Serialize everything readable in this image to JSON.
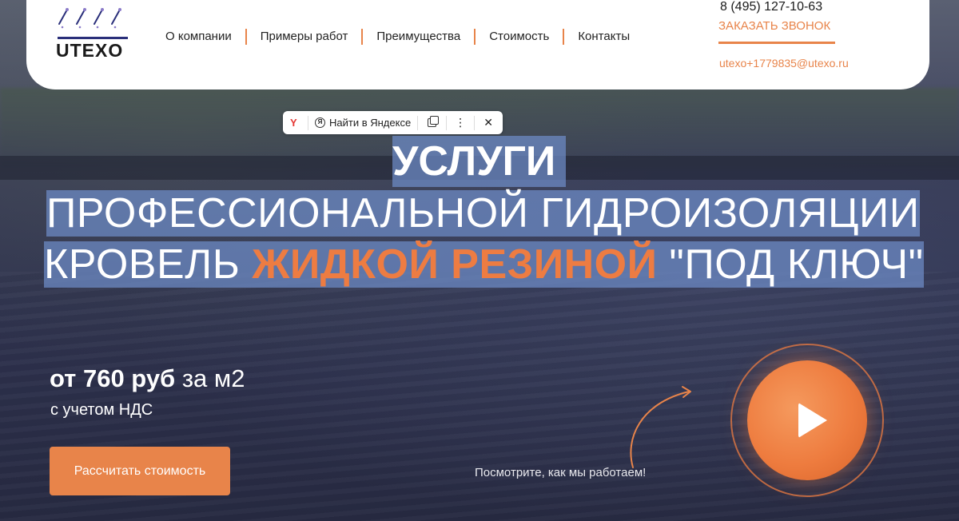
{
  "header": {
    "logo_text": "UTEXO",
    "nav": [
      "О компании",
      "Примеры работ",
      "Преимущества",
      "Стоимость",
      "Контакты"
    ],
    "phone": "8 (495) 127-10-63",
    "callback_label": "ЗАКАЗАТЬ ЗВОНОК",
    "email": "utexo+1779835@utexo.ru"
  },
  "yandex_popup": {
    "search_label": "Найти в Яндексе",
    "icons": [
      "yandex-logo-icon",
      "search-icon",
      "copy-icon",
      "more-icon",
      "close-icon"
    ]
  },
  "headline": {
    "line1": "УСЛУГИ",
    "line2": "ПРОФЕССИОНАЛЬНОЙ ГИДРОИЗОЛЯЦИИ",
    "line3_part1": "КРОВЕЛЬ ",
    "line3_highlight": "ЖИДКОЙ РЕЗИНОЙ",
    "line3_part2": " \"ПОД КЛЮЧ\""
  },
  "price": {
    "prefix": "от 760 руб",
    "unit": " за м2",
    "note": "с учетом НДС"
  },
  "cta_label": "Рассчитать стоимость",
  "video": {
    "caption": "Посмотрите, как мы работаем!"
  },
  "colors": {
    "accent": "#e8844a",
    "selection": "#6e8cc8",
    "logo_blue": "#2a2f7a"
  }
}
